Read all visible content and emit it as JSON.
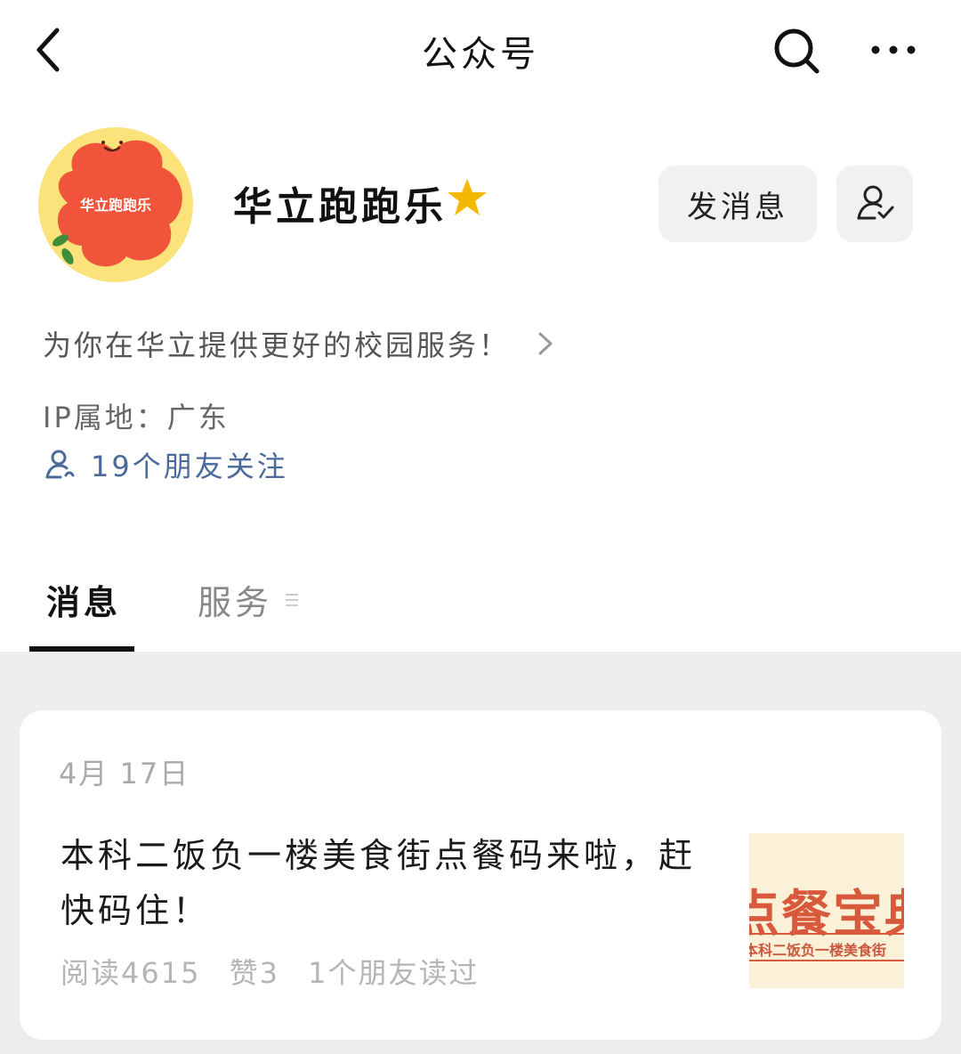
{
  "navbar": {
    "title": "公众号",
    "back_icon": "chevron-left-icon",
    "search_icon": "search-icon",
    "more_icon": "more-dots-icon"
  },
  "profile": {
    "avatar_text": "华立跑跑乐",
    "name": "华立跑跑乐",
    "badge_icon": "star-icon",
    "badge_color": "#f5b800",
    "send_message_label": "发消息",
    "follow_icon": "user-check-icon",
    "bio": "为你在华立提供更好的校园服务！",
    "ip_location": "IP属地：广东",
    "friends_following": "19个朋友关注"
  },
  "tabs": [
    {
      "label": "消息",
      "active": true
    },
    {
      "label": "服务",
      "active": false
    }
  ],
  "articles": [
    {
      "date": "4月 17日",
      "title": "本科二饭负一楼美食街点餐码来啦，赶快码住！",
      "reads": "阅读4615",
      "likes": "赞3",
      "friends_read": "1个朋友读过",
      "thumbnail": {
        "big_text": "点餐宝典",
        "small_text": "本科二饭负一楼美食街"
      }
    }
  ],
  "colors": {
    "avatar_bg": "#fbe27a",
    "avatar_blob": "#f0543a",
    "link_blue": "#4a6a9a",
    "feed_bg": "#ededed"
  }
}
